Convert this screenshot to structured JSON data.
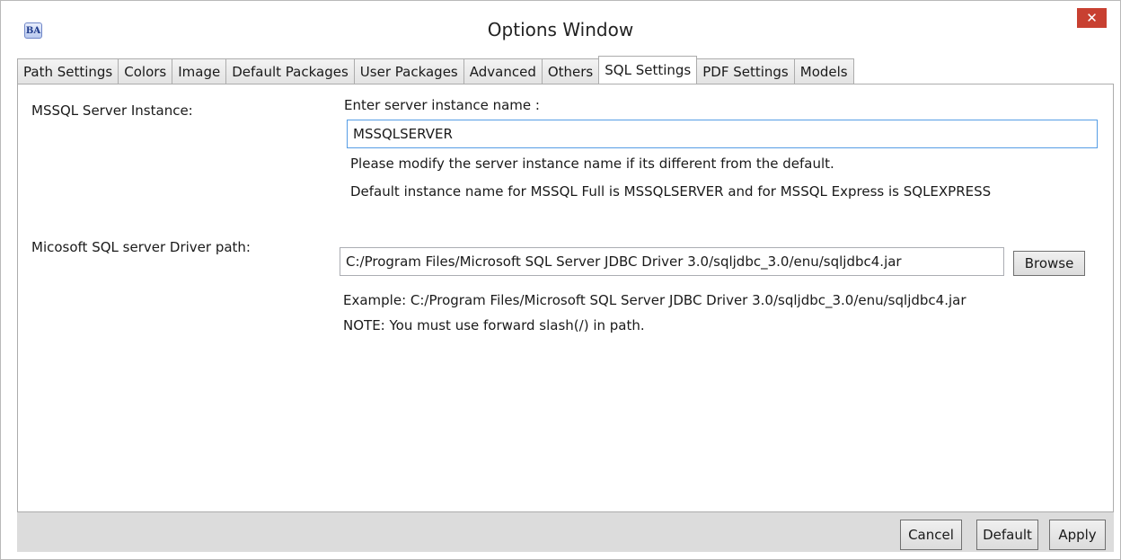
{
  "window": {
    "title": "Options Window",
    "app_icon_text": "BA",
    "close_glyph": "✕"
  },
  "tabs": [
    {
      "label": "Path Settings",
      "active": false
    },
    {
      "label": "Colors",
      "active": false
    },
    {
      "label": "Image",
      "active": false
    },
    {
      "label": "Default Packages",
      "active": false
    },
    {
      "label": "User Packages",
      "active": false
    },
    {
      "label": "Advanced",
      "active": false
    },
    {
      "label": "Others",
      "active": false
    },
    {
      "label": "SQL Settings",
      "active": true
    },
    {
      "label": "PDF Settings",
      "active": false
    },
    {
      "label": "Models",
      "active": false
    }
  ],
  "sql": {
    "instance_label": "MSSQL Server Instance:",
    "instance_prompt": "Enter server instance name :",
    "instance_value": "MSSQLSERVER",
    "instance_hint1": "Please modify the server instance name if its different from the default.",
    "instance_hint2": "Default instance name for MSSQL Full is MSSQLSERVER and for MSSQL Express is SQLEXPRESS",
    "driver_label": "Micosoft SQL server Driver path:",
    "driver_value": "C:/Program Files/Microsoft SQL Server JDBC Driver 3.0/sqljdbc_3.0/enu/sqljdbc4.jar",
    "browse_label": "Browse",
    "driver_example": "Example: C:/Program Files/Microsoft SQL Server JDBC Driver 3.0/sqljdbc_3.0/enu/sqljdbc4.jar",
    "driver_note": "NOTE: You must use forward slash(/) in path."
  },
  "footer": {
    "cancel_label": "Cancel",
    "default_label": "Default",
    "apply_label": "Apply"
  }
}
